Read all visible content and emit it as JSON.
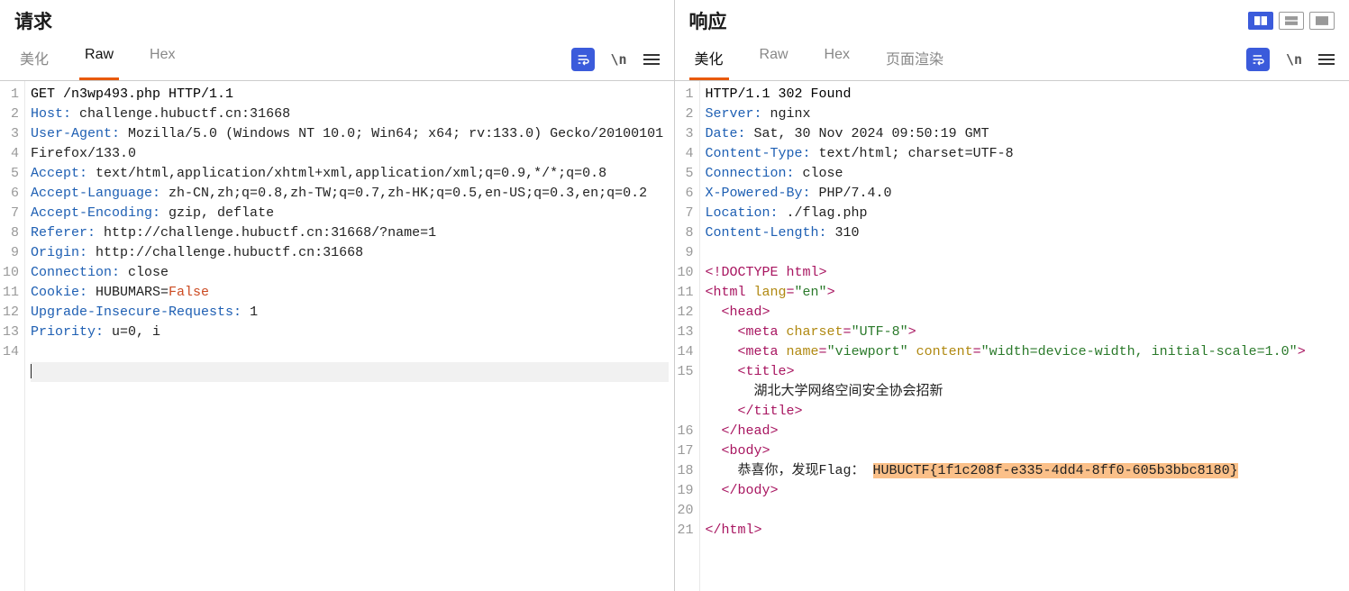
{
  "request": {
    "title": "请求",
    "tabs": {
      "pretty": "美化",
      "raw": "Raw",
      "hex": "Hex"
    },
    "active_tab": "Raw",
    "lines": [
      {
        "n": 1,
        "plain": "GET /n3wp493.php HTTP/1.1"
      },
      {
        "n": 2,
        "header": "Host",
        "value": "challenge.hubuctf.cn:31668"
      },
      {
        "n": 3,
        "header": "User-Agent",
        "value": "Mozilla/5.0 (Windows NT 10.0; Win64; x64; rv:133.0) Gecko/20100101 Firefox/133.0"
      },
      {
        "n": 4,
        "header": "Accept",
        "value": "text/html,application/xhtml+xml,application/xml;q=0.9,*/*;q=0.8"
      },
      {
        "n": 5,
        "header": "Accept-Language",
        "value": "zh-CN,zh;q=0.8,zh-TW;q=0.7,zh-HK;q=0.5,en-US;q=0.3,en;q=0.2"
      },
      {
        "n": 6,
        "header": "Accept-Encoding",
        "value": "gzip, deflate"
      },
      {
        "n": 7,
        "header": "Referer",
        "value": "http://challenge.hubuctf.cn:31668/?name=1"
      },
      {
        "n": 8,
        "header": "Origin",
        "value": "http://challenge.hubuctf.cn:31668"
      },
      {
        "n": 9,
        "header": "Connection",
        "value": "close"
      },
      {
        "n": 10,
        "header": "Cookie",
        "value": "HUBUMARS=",
        "valsuffix": "False"
      },
      {
        "n": 11,
        "header": "Upgrade-Insecure-Requests",
        "value": "1"
      },
      {
        "n": 12,
        "header": "Priority",
        "value": "u=0, i"
      },
      {
        "n": 13,
        "plain": ""
      },
      {
        "n": 14,
        "plain": "",
        "cursor": true
      }
    ]
  },
  "response": {
    "title": "响应",
    "tabs": {
      "pretty": "美化",
      "raw": "Raw",
      "hex": "Hex",
      "render": "页面渲染"
    },
    "active_tab": "美化",
    "lines": [
      {
        "n": 1,
        "plain": "HTTP/1.1 302 Found"
      },
      {
        "n": 2,
        "header": "Server",
        "value": "nginx"
      },
      {
        "n": 3,
        "header": "Date",
        "value": "Sat, 30 Nov 2024 09:50:19 GMT"
      },
      {
        "n": 4,
        "header": "Content-Type",
        "value": "text/html; charset=UTF-8"
      },
      {
        "n": 5,
        "header": "Connection",
        "value": "close"
      },
      {
        "n": 6,
        "header": "X-Powered-By",
        "value": "PHP/7.4.0"
      },
      {
        "n": 7,
        "header": "Location",
        "value": "./flag.php"
      },
      {
        "n": 8,
        "header": "Content-Length",
        "value": "310"
      },
      {
        "n": 9,
        "plain": ""
      },
      {
        "n": 10,
        "html": [
          {
            "t": "tag",
            "s": "<!DOCTYPE html>"
          }
        ]
      },
      {
        "n": 11,
        "html": [
          {
            "t": "tag",
            "s": "<html "
          },
          {
            "t": "attr",
            "s": "lang"
          },
          {
            "t": "tag",
            "s": "="
          },
          {
            "t": "attrval",
            "s": "\"en\""
          },
          {
            "t": "tag",
            "s": ">"
          }
        ]
      },
      {
        "n": 12,
        "indent": 1,
        "html": [
          {
            "t": "tag",
            "s": "<head>"
          }
        ]
      },
      {
        "n": 13,
        "indent": 2,
        "html": [
          {
            "t": "tag",
            "s": "<meta "
          },
          {
            "t": "attr",
            "s": "charset"
          },
          {
            "t": "tag",
            "s": "="
          },
          {
            "t": "attrval",
            "s": "\"UTF-8\""
          },
          {
            "t": "tag",
            "s": ">"
          }
        ]
      },
      {
        "n": 14,
        "indent": 2,
        "html": [
          {
            "t": "tag",
            "s": "<meta "
          },
          {
            "t": "attr",
            "s": "name"
          },
          {
            "t": "tag",
            "s": "="
          },
          {
            "t": "attrval",
            "s": "\"viewport\""
          },
          {
            "t": "tag",
            "s": " "
          },
          {
            "t": "attr",
            "s": "content"
          },
          {
            "t": "tag",
            "s": "="
          },
          {
            "t": "attrval",
            "s": "\"width=device-width, initial-scale=1.0\""
          },
          {
            "t": "tag",
            "s": ">"
          }
        ]
      },
      {
        "n": 15,
        "indent": 2,
        "html": [
          {
            "t": "tag",
            "s": "<title>"
          }
        ]
      },
      {
        "n": "",
        "indent": 3,
        "html": [
          {
            "t": "text",
            "s": "湖北大学网络空间安全协会招新"
          }
        ]
      },
      {
        "n": "",
        "indent": 2,
        "html": [
          {
            "t": "tag",
            "s": "</title>"
          }
        ]
      },
      {
        "n": 16,
        "indent": 1,
        "html": [
          {
            "t": "tag",
            "s": "</head>"
          }
        ]
      },
      {
        "n": 17,
        "indent": 1,
        "html": [
          {
            "t": "tag",
            "s": "<body>"
          }
        ]
      },
      {
        "n": 18,
        "indent": 2,
        "html": [
          {
            "t": "text",
            "s": "恭喜你，发现Flag： "
          },
          {
            "t": "highlight",
            "s": "HUBUCTF{1f1c208f-e335-4dd4-8ff0-605b3bbc8180}"
          }
        ]
      },
      {
        "n": 19,
        "indent": 1,
        "html": [
          {
            "t": "tag",
            "s": "</body>"
          }
        ]
      },
      {
        "n": 20,
        "plain": ""
      },
      {
        "n": 21,
        "html": [
          {
            "t": "tag",
            "s": "</html>"
          }
        ]
      }
    ]
  },
  "newline_label": "\\n"
}
